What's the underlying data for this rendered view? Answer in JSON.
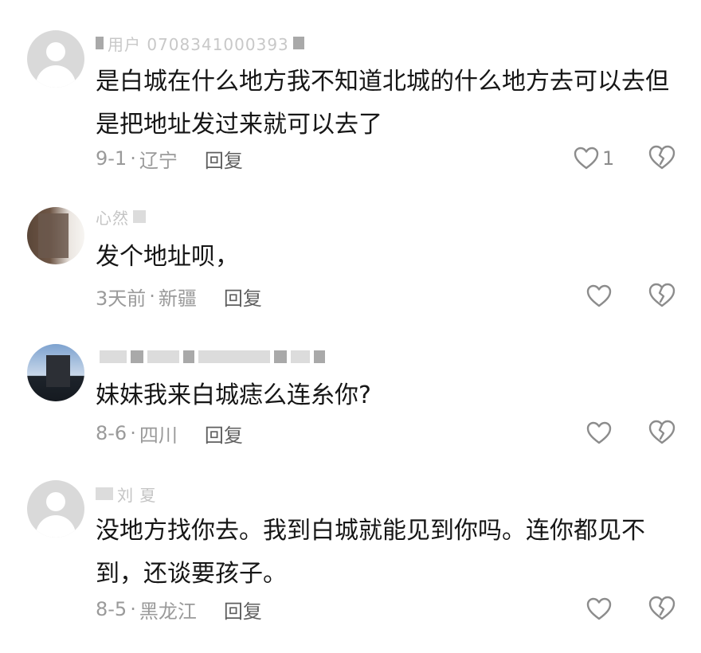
{
  "comments": [
    {
      "username": "用户 0708341000393",
      "text": "是白城在什么地方我不知道北城的什么地方去可以去但是把地址发过来就可以去了",
      "date": "9-1",
      "location": "辽宁",
      "reply_label": "回复",
      "like_count": "1"
    },
    {
      "username": "心然",
      "text": "发个地址呗，",
      "date": "3天前",
      "location": "新疆",
      "reply_label": "回复",
      "like_count": ""
    },
    {
      "username": "",
      "text": "妹妹我来白城痣么连糸你?",
      "date": "8-6",
      "location": "四川",
      "reply_label": "回复",
      "like_count": ""
    },
    {
      "username": "刘 夏",
      "text": "没地方找你去。我到白城就能见到你吗。连你都见不到，还谈要孩子。",
      "date": "8-5",
      "location": "黑龙江",
      "reply_label": "回复",
      "like_count": ""
    }
  ],
  "icons": {
    "like": "heart-outline-icon",
    "dislike": "broken-heart-icon",
    "avatar_default": "default-avatar-icon"
  },
  "colors": {
    "text": "#161616",
    "meta": "#9a9a9a",
    "reply": "#5f5f5f",
    "icon": "#8c8c8c"
  }
}
